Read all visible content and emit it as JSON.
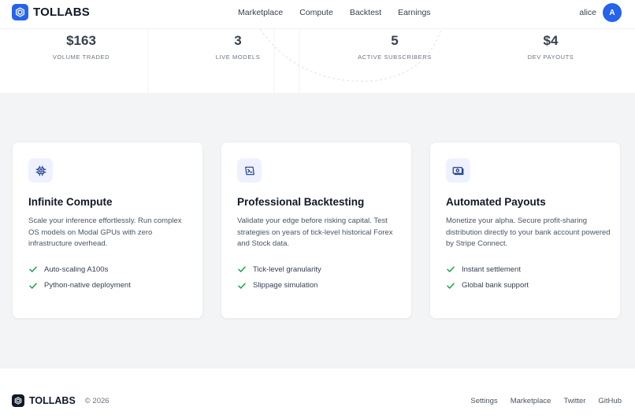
{
  "header": {
    "brand": "TOLLABS",
    "nav": [
      "Marketplace",
      "Compute",
      "Backtest",
      "Earnings"
    ],
    "username": "alice",
    "avatar_initial": "A"
  },
  "stats": [
    {
      "value": "$163",
      "label": "VOLUME TRADED"
    },
    {
      "value": "3",
      "label": "LIVE MODELS"
    },
    {
      "value": "5",
      "label": "ACTIVE SUBSCRIBERS"
    },
    {
      "value": "$4",
      "label": "DEV PAYOUTS"
    }
  ],
  "features": [
    {
      "icon": "cpu-icon",
      "title": "Infinite Compute",
      "desc": "Scale your inference effortlessly. Run complex OS models on Modal GPUs with zero infrastructure overhead.",
      "bullets": [
        "Auto-scaling A100s",
        "Python-native deployment"
      ]
    },
    {
      "icon": "chart-icon",
      "title": "Professional Backtesting",
      "desc": "Validate your edge before risking capital. Test strategies on years of tick-level historical Forex and Stock data.",
      "bullets": [
        "Tick-level granularity",
        "Slippage simulation"
      ]
    },
    {
      "icon": "money-icon",
      "title": "Automated Payouts",
      "desc": "Monetize your alpha. Secure profit-sharing distribution directly to your bank account powered by Stripe Connect.",
      "bullets": [
        "Instant settlement",
        "Global bank support"
      ]
    }
  ],
  "footer": {
    "brand": "TOLLABS",
    "copyright": "© 2026",
    "links": [
      "Settings",
      "Marketplace",
      "Twitter",
      "GitHub"
    ]
  },
  "colors": {
    "accent": "#2563eb",
    "check": "#16a34a",
    "section_bg": "#f3f4f6"
  }
}
